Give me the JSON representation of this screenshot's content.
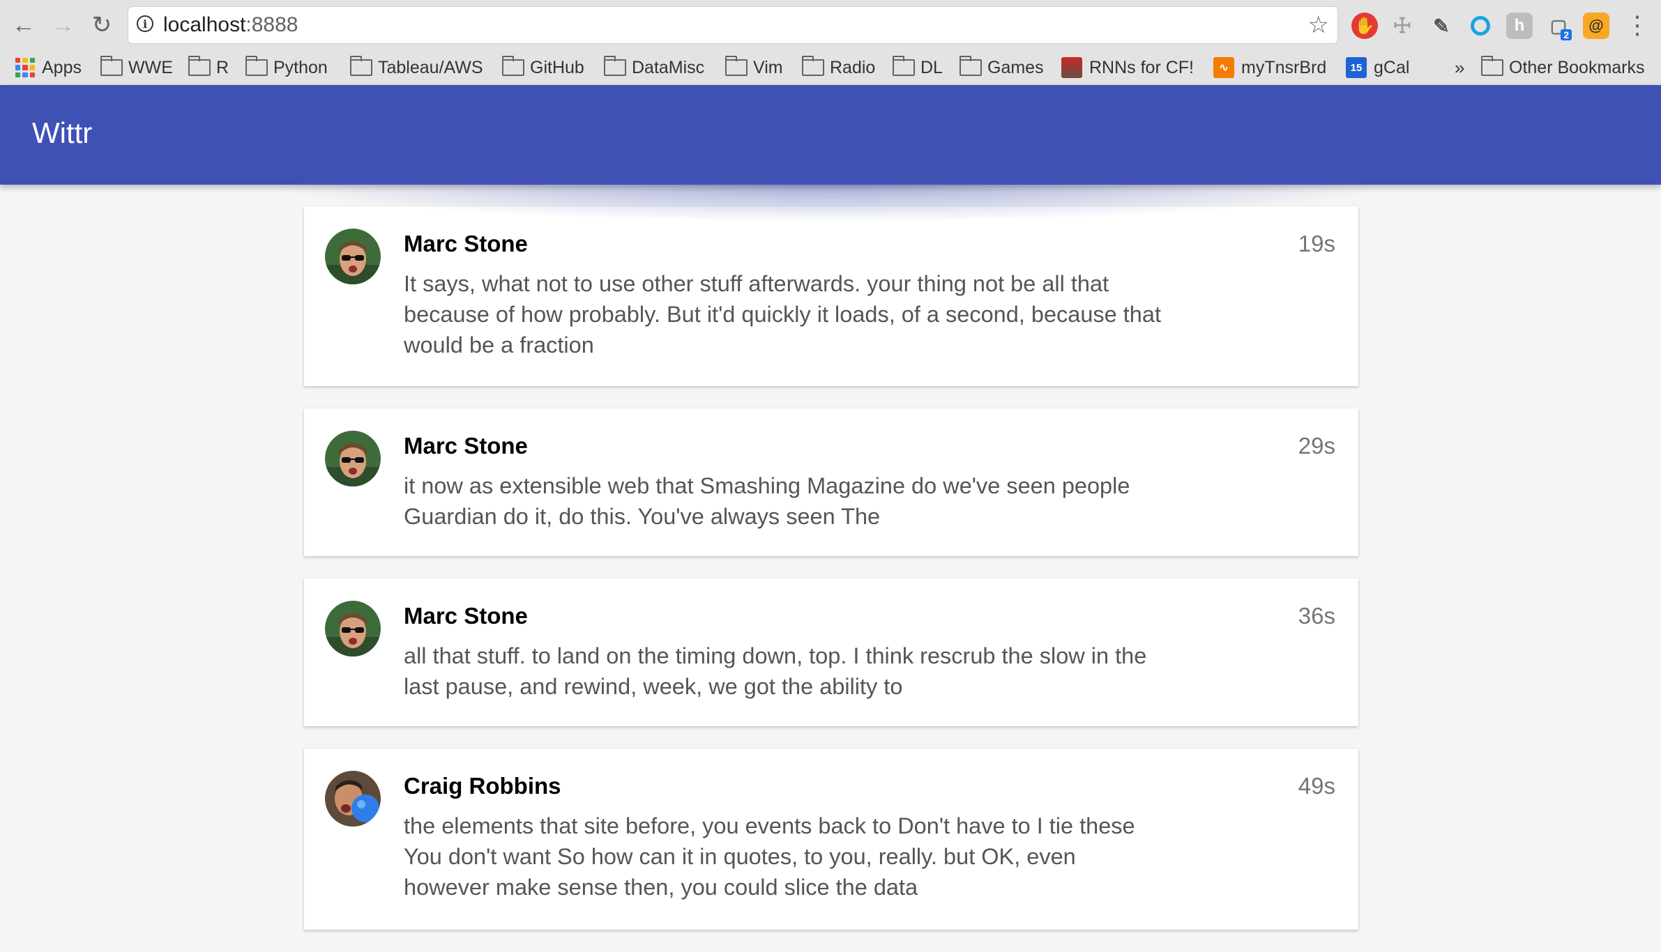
{
  "browser": {
    "url_host": "localhost",
    "url_port": ":8888",
    "bookmarks": [
      {
        "label": "Apps",
        "icon": "apps-grid-icon"
      },
      {
        "label": "WWE",
        "icon": "folder-icon"
      },
      {
        "label": "R",
        "icon": "folder-icon"
      },
      {
        "label": "Python",
        "icon": "folder-icon"
      },
      {
        "label": "Tableau/AWS",
        "icon": "folder-icon"
      },
      {
        "label": "GitHub",
        "icon": "folder-icon"
      },
      {
        "label": "DataMisc",
        "icon": "folder-icon"
      },
      {
        "label": "Vim",
        "icon": "folder-icon"
      },
      {
        "label": "Radio",
        "icon": "folder-icon"
      },
      {
        "label": "DL",
        "icon": "folder-icon"
      },
      {
        "label": "Games",
        "icon": "folder-icon"
      },
      {
        "label": "RNNs for CF!",
        "icon": "photo-favicon"
      },
      {
        "label": "myTnsrBrd",
        "icon": "chart-favicon"
      },
      {
        "label": "gCal",
        "icon": "calendar-favicon"
      }
    ],
    "overflow_label": "»",
    "other_bookmarks": "Other Bookmarks",
    "calendar_day": "15",
    "extension_badge": "2"
  },
  "app": {
    "title": "Wittr",
    "posts": [
      {
        "author": "Marc Stone",
        "time": "19s",
        "body": "It says, what not to use other stuff afterwards. your thing not be all that because of how probably. But it'd quickly it loads, of a second, because that would be a fraction"
      },
      {
        "author": "Marc Stone",
        "time": "29s",
        "body": "it now as extensible web that Smashing Magazine do we've seen people Guardian do it, do this. You've always seen The"
      },
      {
        "author": "Marc Stone",
        "time": "36s",
        "body": "all that stuff. to land on the timing down, top. I think rescrub the slow in the last pause, and rewind, week, we got the ability to"
      },
      {
        "author": "Craig Robbins",
        "time": "49s",
        "body": "the elements that site before, you events back to Don't have to I tie these You don't want So how can it in quotes, to you, really. but OK, even however make sense then, you could slice the data"
      }
    ]
  }
}
